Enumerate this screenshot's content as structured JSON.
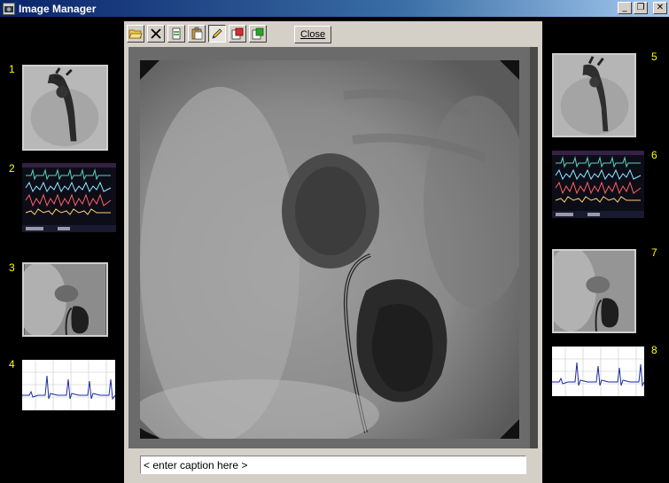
{
  "window": {
    "title": "Image Manager",
    "minimize_glyph": "_",
    "restore_glyph": "❐",
    "close_glyph": "✕"
  },
  "thumbnails": [
    {
      "number": "1",
      "kind": "angiogram",
      "icon": "angiogram-thumbnail"
    },
    {
      "number": "2",
      "kind": "monitor",
      "icon": "monitor-waveform-thumbnail"
    },
    {
      "number": "3",
      "kind": "angiogram",
      "icon": "angiogram-thumbnail"
    },
    {
      "number": "4",
      "kind": "ecg",
      "icon": "ecg-strip-thumbnail"
    },
    {
      "number": "5",
      "kind": "angiogram",
      "icon": "angiogram-thumbnail"
    },
    {
      "number": "6",
      "kind": "monitor",
      "icon": "monitor-waveform-thumbnail"
    },
    {
      "number": "7",
      "kind": "angiogram",
      "icon": "angiogram-thumbnail"
    },
    {
      "number": "8",
      "kind": "ecg",
      "icon": "ecg-strip-thumbnail"
    }
  ],
  "toolbar": {
    "buttons": [
      "open-folder-icon",
      "delete-icon",
      "refresh-icon",
      "paste-icon",
      "edit-pencil-icon",
      "export-icon",
      "import-icon"
    ],
    "close_label": "Close"
  },
  "caption": {
    "value": "< enter caption here >"
  },
  "colors": {
    "background": "#000000",
    "panel": "#d4d0c8",
    "number_label": "#ffff00",
    "titlebar_start": "#0a246a",
    "titlebar_end": "#a6caf0"
  }
}
